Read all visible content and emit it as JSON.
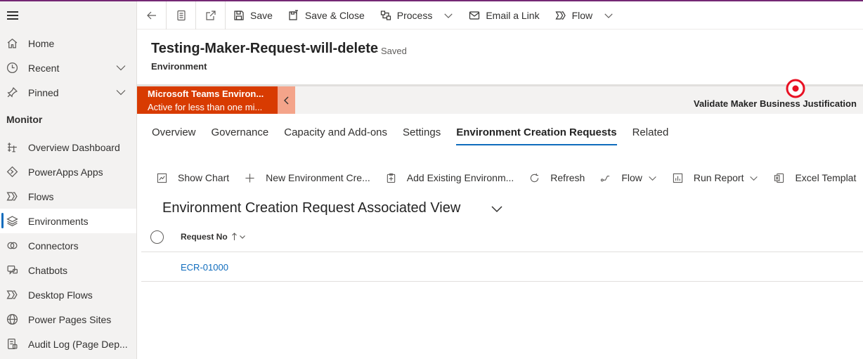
{
  "colors": {
    "brand_purple": "#742774",
    "accent_blue": "#0f6cbd",
    "bpf_active": "#d83b01",
    "stage_red": "#e81123"
  },
  "sidebar": {
    "items": [
      {
        "label": "Home",
        "icon": "home-icon"
      },
      {
        "label": "Recent",
        "icon": "clock-icon",
        "expandable": true
      },
      {
        "label": "Pinned",
        "icon": "pin-icon",
        "expandable": true
      }
    ],
    "section_title": "Monitor",
    "monitor_items": [
      {
        "label": "Overview Dashboard",
        "icon": "dashboard-icon"
      },
      {
        "label": "PowerApps Apps",
        "icon": "powerapps-icon"
      },
      {
        "label": "Flows",
        "icon": "flow-icon"
      },
      {
        "label": "Environments",
        "icon": "layers-icon",
        "active": true
      },
      {
        "label": "Connectors",
        "icon": "connector-icon"
      },
      {
        "label": "Chatbots",
        "icon": "chatbot-icon"
      },
      {
        "label": "Desktop Flows",
        "icon": "desktop-flow-icon"
      },
      {
        "label": "Power Pages Sites",
        "icon": "globe-icon"
      },
      {
        "label": "Audit Log (Page Dep...",
        "icon": "audit-log-icon"
      }
    ]
  },
  "toolbar": {
    "save": "Save",
    "save_close": "Save & Close",
    "process": "Process",
    "email_link": "Email a Link",
    "flow": "Flow"
  },
  "record": {
    "title": "Testing-Maker-Request-will-delete",
    "status": "- Saved",
    "entity": "Environment"
  },
  "bpf": {
    "process_name": "Microsoft Teams Environ...",
    "process_status": "Active for less than one mi...",
    "stage": "Validate Maker Business Justification"
  },
  "tabs": [
    "Overview",
    "Governance",
    "Capacity and Add-ons",
    "Settings",
    "Environment Creation Requests",
    "Related"
  ],
  "active_tab": "Environment Creation Requests",
  "subgrid_toolbar": {
    "show_chart": "Show Chart",
    "new": "New Environment Cre...",
    "add_existing": "Add Existing Environm...",
    "refresh": "Refresh",
    "flow": "Flow",
    "run_report": "Run Report",
    "excel": "Excel Templat"
  },
  "view": {
    "title": "Environment Creation Request Associated View",
    "column": "Request No",
    "rows": [
      "ECR-01000"
    ]
  }
}
